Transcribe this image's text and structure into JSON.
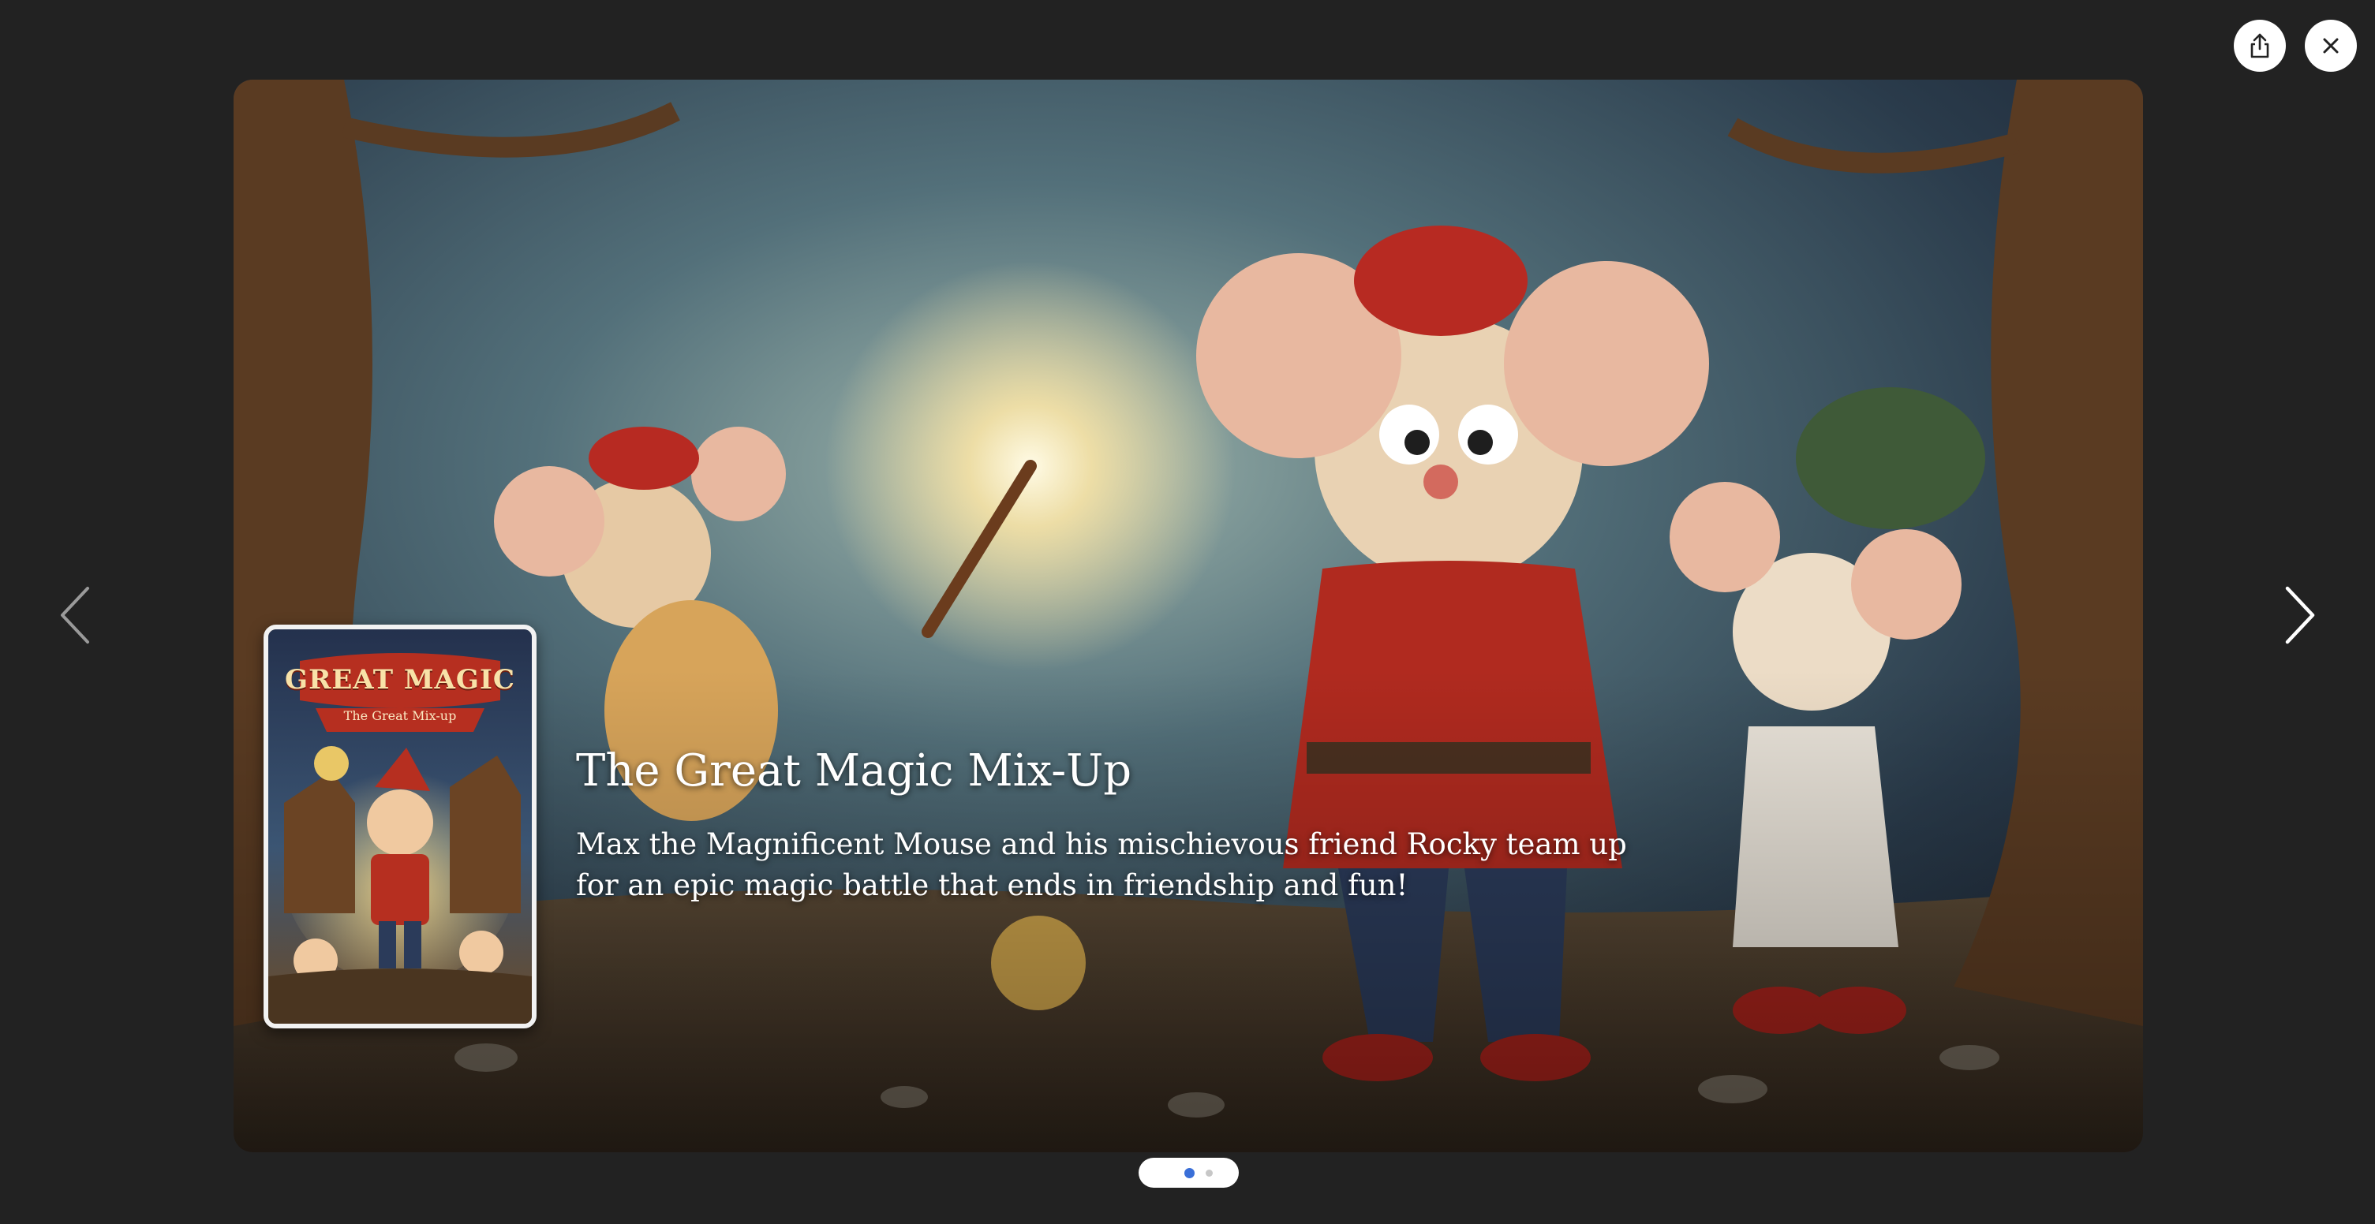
{
  "viewer": {
    "icons": {
      "share": "share-icon",
      "close": "close-icon",
      "prev": "chevron-left-icon",
      "next": "chevron-right-icon"
    }
  },
  "slide": {
    "title": "The Great Magic Mix-Up",
    "description": "Max the Magnificent Mouse and his mischievous friend Rocky team up for an epic magic battle that ends in friendship and fun!",
    "book_cover": {
      "title": "GREAT MAGIC",
      "subtitle": "The Great Mix-up"
    }
  },
  "pager": {
    "total": 2,
    "active_index": 1
  },
  "colors": {
    "background": "#222222",
    "active_dot": "#3a6fd8",
    "inactive_dot": "#c7c7c7"
  }
}
